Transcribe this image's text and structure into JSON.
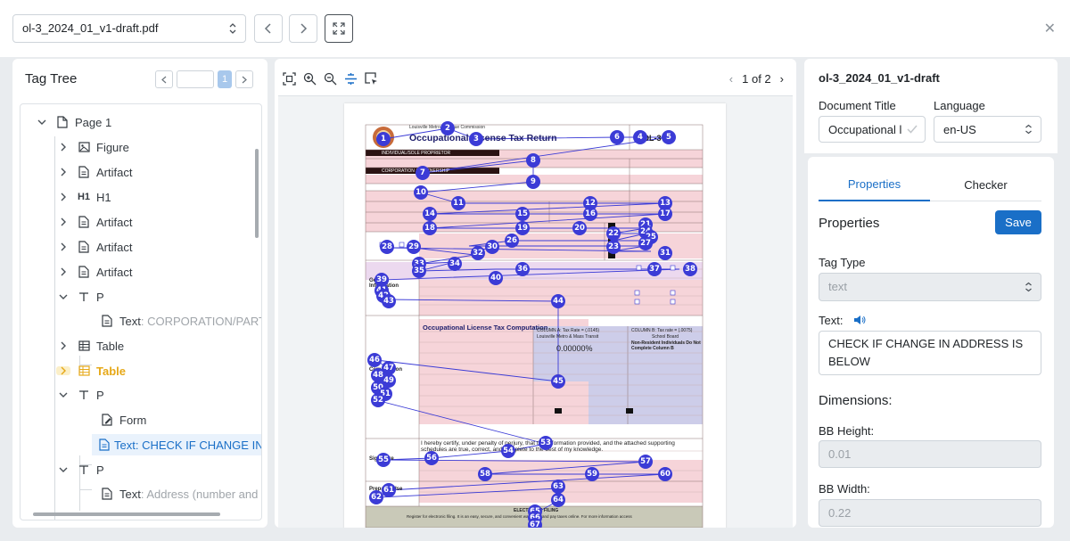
{
  "toolbar": {
    "file_name": "ol-3_2024_01_v1-draft.pdf"
  },
  "tag_tree": {
    "title": "Tag Tree",
    "page_number": "1",
    "items": [
      {
        "label": "Page 1",
        "sub": ""
      },
      {
        "label": "Figure",
        "sub": ""
      },
      {
        "label": "Artifact",
        "sub": ""
      },
      {
        "label": "H1",
        "sub": ""
      },
      {
        "label": "Artifact",
        "sub": ""
      },
      {
        "label": "Artifact",
        "sub": ""
      },
      {
        "label": "Artifact",
        "sub": ""
      },
      {
        "label": "P",
        "sub": ""
      },
      {
        "label": "Text",
        "sub": ": CORPORATION/PARTI"
      },
      {
        "label": "Table",
        "sub": ""
      },
      {
        "label": "Table",
        "sub": ""
      },
      {
        "label": "P",
        "sub": ""
      },
      {
        "label": "Form",
        "sub": ""
      },
      {
        "label": "Text",
        "sub": ": CHECK IF CHANGE IN"
      },
      {
        "label": "P",
        "sub": ""
      },
      {
        "label": "Text",
        "sub": ": Address (number and s"
      }
    ],
    "h1_icon_text": "H1",
    "accent_color": "#e6a817"
  },
  "viewer": {
    "page_indicator": "1 of 2",
    "document": {
      "commission": "Louisville Metro Revenue Commission",
      "title": "Occupational License Tax Return",
      "form_code": "OL-3",
      "section_individual": "INDIVIDUAL/SOLE PROPRIETOR",
      "section_corporation": "CORPORATION / PARTNERSHIP",
      "computation_title": "Occupational License Tax Computation",
      "column_a": "COLUMN A: Tax Rate = (.0145)",
      "column_a_sub": "Louisville Metro & Mass Transit",
      "column_b": "COLUMN B: Tax rate = (.0075)",
      "column_b_sub": "School Board",
      "percent": "0.00000%",
      "non_resident": "Non-Resident Individuals Do Not Complete Column B",
      "certify": "I hereby certify, under penalty of perjury, that this information provided, and the attached supporting schedules are true, correct, and complete to the best of my knowledge.",
      "efiling": "ELECTRONIC FILING",
      "efiling_note": "Register for electronic filing. It is an easy, secure, and convenient way to file and pay taxes online. For more information access",
      "general_info": "General Information",
      "computation_label": "Computation",
      "signature_label": "Signature",
      "preparer_label": "Preparer Use",
      "markers": [
        "1",
        "2",
        "3",
        "4",
        "5",
        "6",
        "7",
        "8",
        "9",
        "10",
        "11",
        "12",
        "13",
        "14",
        "15",
        "16",
        "17",
        "18",
        "19",
        "20",
        "21",
        "22",
        "23",
        "24",
        "25",
        "26",
        "27",
        "28",
        "29",
        "30",
        "31",
        "32",
        "33",
        "34",
        "35",
        "36",
        "37",
        "38",
        "39",
        "40",
        "41",
        "42",
        "43",
        "44",
        "45",
        "46",
        "47",
        "48",
        "49",
        "50",
        "51",
        "52",
        "53",
        "54",
        "55",
        "56",
        "57",
        "58",
        "59",
        "60",
        "61",
        "62",
        "63",
        "64",
        "65",
        "66",
        "67"
      ]
    },
    "marker_color": "#3b3bd6"
  },
  "details": {
    "doc_name": "ol-3_2024_01_v1-draft",
    "document_title_label": "Document Title",
    "document_title_value": "Occupational l",
    "language_label": "Language",
    "language_value": "en-US",
    "tabs": [
      "Properties",
      "Checker"
    ],
    "properties_heading": "Properties",
    "save_label": "Save",
    "tag_type_label": "Tag Type",
    "tag_type_value": "text",
    "text_label": "Text:",
    "text_value": "CHECK IF CHANGE IN ADDRESS IS BELOW",
    "dimensions_heading": "Dimensions:",
    "bb_height_label": "BB Height:",
    "bb_height_value": "0.01",
    "bb_width_label": "BB Width:",
    "bb_width_value": "0.22",
    "primary_color": "#1a6fc7"
  }
}
